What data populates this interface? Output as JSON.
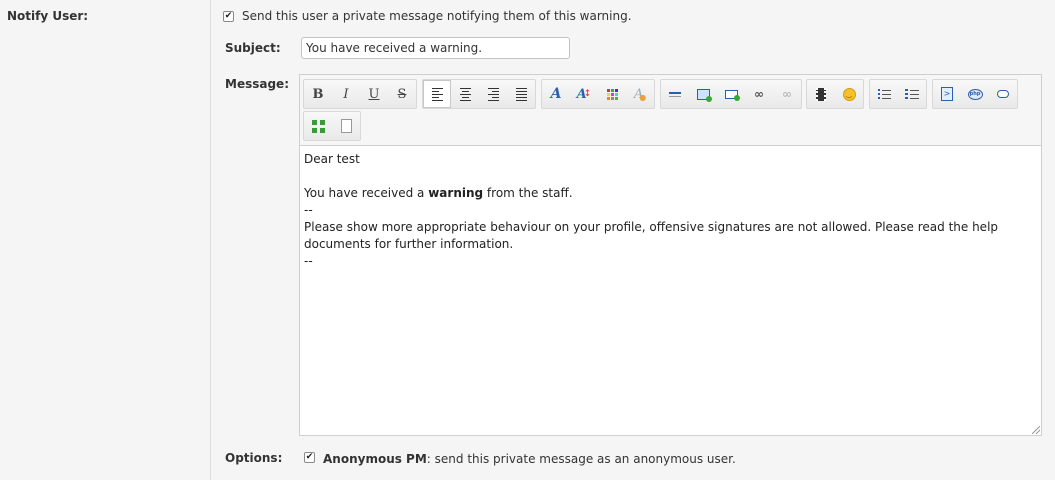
{
  "notify": {
    "label": "Notify User:",
    "checkbox_checked": true,
    "checkbox_text": "Send this user a private message notifying them of this warning."
  },
  "subject": {
    "label": "Subject:",
    "value": "You have received a warning."
  },
  "message": {
    "label": "Message:",
    "toolbar_icons": [
      "bold-icon",
      "italic-icon",
      "underline-icon",
      "strikethrough-icon",
      "align-left-icon",
      "align-center-icon",
      "align-right-icon",
      "align-justify-icon",
      "font-icon",
      "font-size-icon",
      "text-color-icon",
      "remove-format-icon",
      "horizontal-rule-icon",
      "image-icon",
      "email-icon",
      "link-icon",
      "unlink-icon",
      "video-icon",
      "emoticon-icon",
      "bullet-list-icon",
      "numbered-list-icon",
      "code-icon",
      "php-icon",
      "quote-icon",
      "fullscreen-icon",
      "source-icon"
    ],
    "body_line1": "Dear test",
    "body_line2_pre": "You have received a ",
    "body_line2_bold": "warning",
    "body_line2_post": " from the staff.",
    "body_line3": "--",
    "body_line4": "Please show more appropriate behaviour on your profile, offensive signatures are not allowed. Please read the help documents for further information.",
    "body_line5": "--"
  },
  "options": {
    "label": "Options:",
    "checkbox_checked": true,
    "anon_bold": "Anonymous PM",
    "anon_rest": ": send this private message as an anonymous user."
  },
  "colors": {
    "background": "#f5f5f5",
    "accent_blue": "#2a5fb0"
  }
}
